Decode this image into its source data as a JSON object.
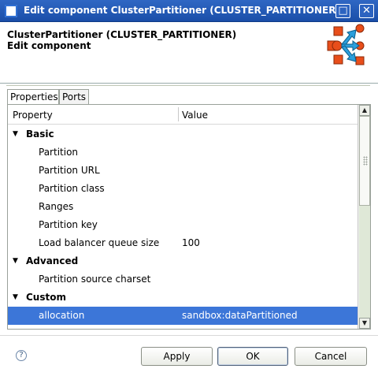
{
  "window": {
    "title": "Edit component ClusterPartitioner (CLUSTER_PARTITIONER)",
    "minimize_glyph": "□",
    "close_glyph": "✕"
  },
  "banner": {
    "title": "ClusterPartitioner (CLUSTER_PARTITIONER)",
    "subtitle": "Edit component",
    "logo_icon": "cluster-partitioner-icon"
  },
  "tabs": [
    {
      "label": "Properties",
      "active": true
    },
    {
      "label": "Ports",
      "active": false
    }
  ],
  "table": {
    "columns": [
      "Property",
      "Value"
    ],
    "rows": [
      {
        "type": "group",
        "label": "Basic",
        "arrow": "▼"
      },
      {
        "type": "prop",
        "label": "Partition",
        "value": ""
      },
      {
        "type": "prop",
        "label": "Partition URL",
        "value": ""
      },
      {
        "type": "prop",
        "label": "Partition class",
        "value": ""
      },
      {
        "type": "prop",
        "label": "Ranges",
        "value": ""
      },
      {
        "type": "prop",
        "label": "Partition key",
        "value": ""
      },
      {
        "type": "prop",
        "label": "Load balancer queue size",
        "value": "100"
      },
      {
        "type": "group",
        "label": "Advanced",
        "arrow": "▼"
      },
      {
        "type": "prop",
        "label": "Partition source charset",
        "value": ""
      },
      {
        "type": "group",
        "label": "Custom",
        "arrow": "▼"
      },
      {
        "type": "prop",
        "label": "allocation",
        "value": "sandbox:dataPartitioned",
        "selected": true
      }
    ]
  },
  "scroll": {
    "up_glyph": "▲",
    "down_glyph": "▼"
  },
  "footer": {
    "help_glyph": "?",
    "apply_label": "Apply",
    "ok_label": "OK",
    "cancel_label": "Cancel"
  },
  "colors": {
    "titlebar": "#2f67c4",
    "selection": "#3c76d8",
    "logo_orange": "#e84e1b",
    "logo_blue": "#2b9fdc"
  }
}
